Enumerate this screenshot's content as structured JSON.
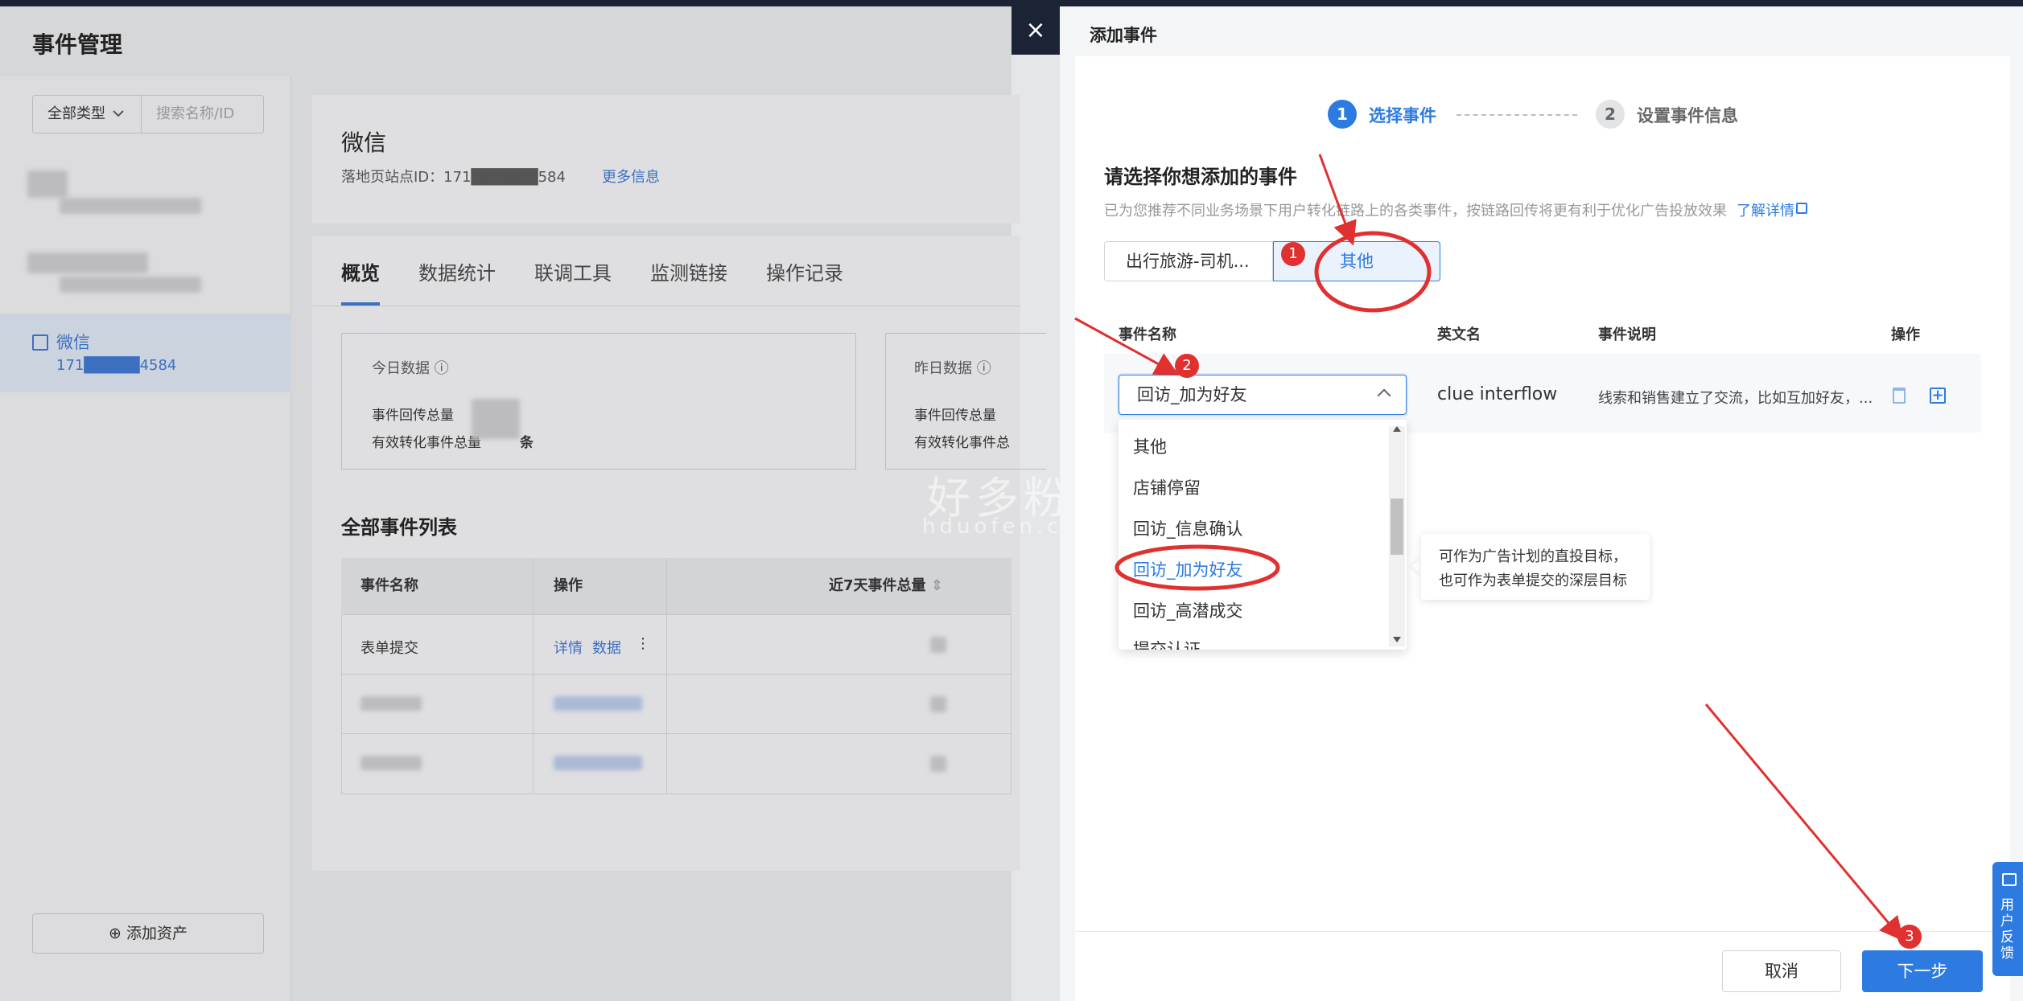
{
  "background": {
    "page_title": "事件管理",
    "type_filter": "全部类型",
    "search_placeholder": "搜索名称/ID",
    "active_asset": {
      "name": "微信",
      "id": "171█████4584"
    },
    "add_asset_label": "添加资产",
    "asset_title": "微信",
    "site_id_label": "落地页站点ID：171██████584",
    "more_info": "更多信息",
    "tabs": [
      "概览",
      "数据统计",
      "联调工具",
      "监测链接",
      "操作记录"
    ],
    "today_label": "今日数据",
    "yesterday_label": "昨日数据",
    "stat_total": "事件回传总量",
    "stat_effective": "有效转化事件总量",
    "stat_effective_short": "有效转化事件总",
    "stat_unit": "条",
    "list_title": "全部事件列表",
    "table_headers": [
      "事件名称",
      "操作",
      "近7天事件总量"
    ],
    "first_row": {
      "name": "表单提交",
      "detail": "详情",
      "data": "数据"
    },
    "watermark": "好多粉",
    "watermark_url": "hduofen.com"
  },
  "drawer": {
    "title": "添加事件",
    "close_icon": "×",
    "steps": [
      {
        "number": "1",
        "label": "选择事件"
      },
      {
        "number": "2",
        "label": "设置事件信息"
      }
    ],
    "section_title": "请选择你想添加的事件",
    "description": "已为您推荐不同业务场景下用户转化链路上的各类事件，按链路回传将更有利于优化广告投放效果",
    "learn_more": "了解详情",
    "segments": [
      "出行旅游-司机...",
      "其他"
    ],
    "table_headers": {
      "name": "事件名称",
      "english": "英文名",
      "desc": "事件说明",
      "action": "操作"
    },
    "row": {
      "selected_event": "回访_加为好友",
      "english_name": "clue interflow",
      "description": "线索和销售建立了交流，比如互加好友，..."
    },
    "dropdown_options": [
      "其他",
      "店铺停留",
      "回访_信息确认",
      "回访_加为好友",
      "回访_高潜成交",
      "提交认证"
    ],
    "tooltip_lines": [
      "可作为广告计划的直投目标，",
      "也可作为表单提交的深层目标"
    ],
    "cancel_label": "取消",
    "next_label": "下一步"
  },
  "feedback_label": "用户反馈",
  "annotations": {
    "badges": [
      "1",
      "2",
      "3"
    ],
    "color": "#e03030"
  },
  "colors": {
    "primary": "#2d7be0",
    "topbar": "#1b2435"
  }
}
